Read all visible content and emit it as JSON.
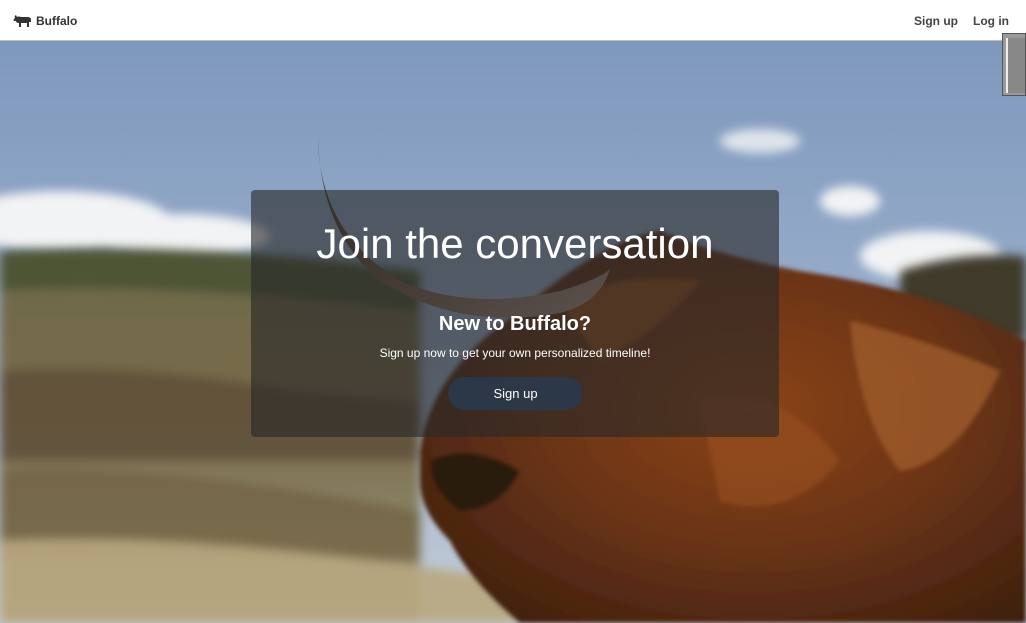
{
  "navbar": {
    "brand": {
      "icon": "buffalo-icon",
      "label": "Buffalo"
    },
    "links": [
      {
        "label": "Sign up"
      },
      {
        "label": "Log in"
      }
    ]
  },
  "debug_tab": {
    "icon": "debug-toolbar-icon"
  },
  "hero": {
    "image": "highland-cow-background-image",
    "title": "Join the conversation",
    "subtitle": "New to Buffalo?",
    "text": "Sign up now to get your own personalized timeline!",
    "button_label": "Sign up"
  },
  "colors": {
    "navbar_bg": "#ffffff",
    "card_bg": "rgba(40,40,40,0.62)",
    "button_bg": "#2c3747"
  }
}
